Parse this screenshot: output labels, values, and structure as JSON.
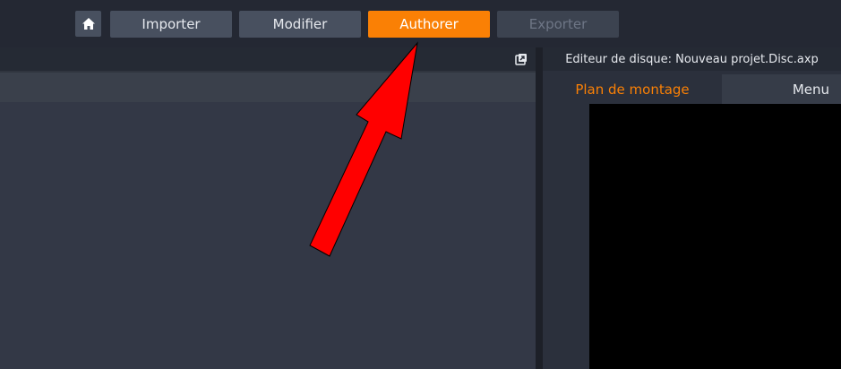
{
  "toolbar": {
    "home_icon": "home-icon",
    "tabs": [
      {
        "label": "Importer",
        "state": "normal"
      },
      {
        "label": "Modifier",
        "state": "normal"
      },
      {
        "label": "Authorer",
        "state": "active"
      },
      {
        "label": "Exporter",
        "state": "disabled"
      }
    ]
  },
  "left_panel": {
    "detach_icon": "detach-window-icon"
  },
  "right_panel": {
    "header_title": "Editeur de disque: Nouveau projet.Disc.axp",
    "tabs": [
      {
        "label": "Plan de montage",
        "state": "active"
      },
      {
        "label": "Menu",
        "state": "normal"
      }
    ]
  },
  "annotation": {
    "type": "red-arrow",
    "points_to": "Authorer",
    "color": "#ff0000"
  },
  "colors": {
    "accent": "#fa8005",
    "toolbar_bg": "#242833",
    "button_bg": "#48505f",
    "panel_bg": "#333846",
    "preview_bg": "#000000"
  }
}
